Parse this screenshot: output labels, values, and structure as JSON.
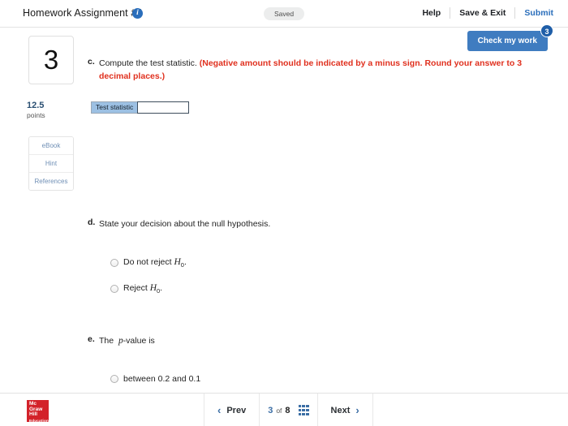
{
  "topbar": {
    "title": "Homework Assignment #4",
    "info_icon": "info-icon",
    "saved_label": "Saved",
    "help_label": "Help",
    "save_exit_label": "Save & Exit",
    "submit_label": "Submit"
  },
  "check_my_work": {
    "label": "Check my work",
    "badge": "3",
    "color": "#3f7cc0"
  },
  "left_rail": {
    "question_number": "3",
    "points_value": "12.5",
    "points_label": "points",
    "tools": [
      {
        "label": "eBook",
        "name": "ebook-button"
      },
      {
        "label": "Hint",
        "name": "hint-button"
      },
      {
        "label": "References",
        "name": "references-button"
      }
    ]
  },
  "parts": {
    "c": {
      "letter": "c.",
      "prompt": "Compute the test statistic.",
      "instruction": "(Negative amount should be indicated by a minus sign. Round your answer to 3 decimal places.)",
      "answer_label": "Test statistic",
      "answer_value": "",
      "answer_placeholder": ""
    },
    "d": {
      "letter": "d.",
      "prompt": "State your decision about the null hypothesis.",
      "options": [
        {
          "prefix": "Do not reject ",
          "symbol": "H",
          "sub": "0",
          "suffix": "."
        },
        {
          "prefix": "Reject ",
          "symbol": "H",
          "sub": "0",
          "suffix": "."
        }
      ]
    },
    "e": {
      "letter": "e.",
      "prompt_before": "The ",
      "prompt_italic": "p",
      "prompt_after": "-value is",
      "options": [
        {
          "label": "between 0.2 and 0.1"
        }
      ]
    }
  },
  "footer": {
    "logo": {
      "line1": "Mc",
      "line2": "Graw",
      "line3": "Hill",
      "line4": "Education",
      "color": "#d3222a"
    },
    "prev_label": "Prev",
    "next_label": "Next",
    "prev_chevron": "‹",
    "next_chevron": "›",
    "current_page": "3",
    "of_label": "of",
    "total_pages": "8",
    "grid_icon": "grid-menu-icon"
  }
}
